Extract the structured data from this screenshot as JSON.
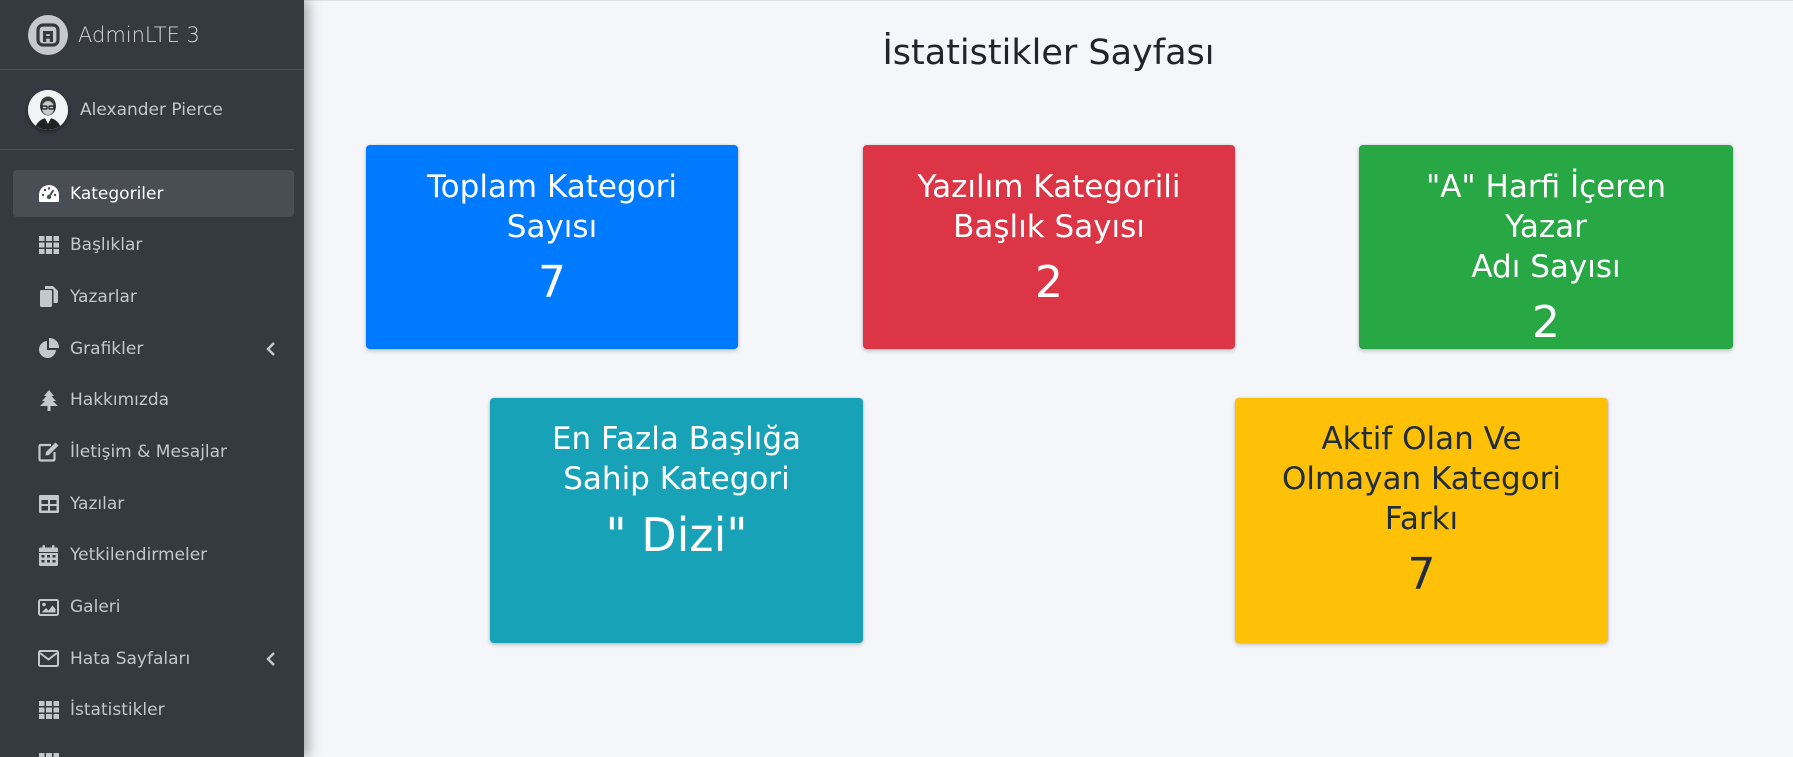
{
  "brand": {
    "title": "AdminLTE 3"
  },
  "user": {
    "name": "Alexander Pierce"
  },
  "nav": [
    {
      "label": "Kategoriler",
      "icon": "tachometer-icon",
      "active": true
    },
    {
      "label": "Başlıklar",
      "icon": "th-icon"
    },
    {
      "label": "Yazarlar",
      "icon": "copy-icon"
    },
    {
      "label": "Grafikler",
      "icon": "chart-pie-icon",
      "has_submenu": true
    },
    {
      "label": "Hakkımızda",
      "icon": "tree-icon"
    },
    {
      "label": "İletişim & Mesajlar",
      "icon": "edit-icon"
    },
    {
      "label": "Yazılar",
      "icon": "table-icon"
    },
    {
      "label": "Yetkilendirmeler",
      "icon": "calendar-icon"
    },
    {
      "label": "Galeri",
      "icon": "image-icon"
    },
    {
      "label": "Hata Sayfaları",
      "icon": "envelope-icon",
      "has_submenu": true
    },
    {
      "label": "İstatistikler",
      "icon": "th-icon"
    }
  ],
  "page": {
    "title": "İstatistikler Sayfası"
  },
  "cards": [
    {
      "title_lines": [
        "Toplam Kategori",
        "Sayısı"
      ],
      "value": "7",
      "color": "#007bff"
    },
    {
      "title_lines": [
        "Yazılım Kategorili",
        "Başlık Sayısı"
      ],
      "value": "2",
      "color": "#dc3545"
    },
    {
      "title_lines": [
        "\"A\" Harfi İçeren Yazar",
        "Adı Sayısı"
      ],
      "value": "2",
      "color": "#28a745"
    },
    {
      "title_lines": [
        "En Fazla Başlığa",
        "Sahip Kategori"
      ],
      "value": "\" Dizi\"",
      "color": "#17a2b8"
    },
    {
      "title_lines": [
        "Aktif Olan Ve",
        "Olmayan Kategori",
        "Farkı"
      ],
      "value": "7",
      "color": "#ffc107"
    }
  ]
}
